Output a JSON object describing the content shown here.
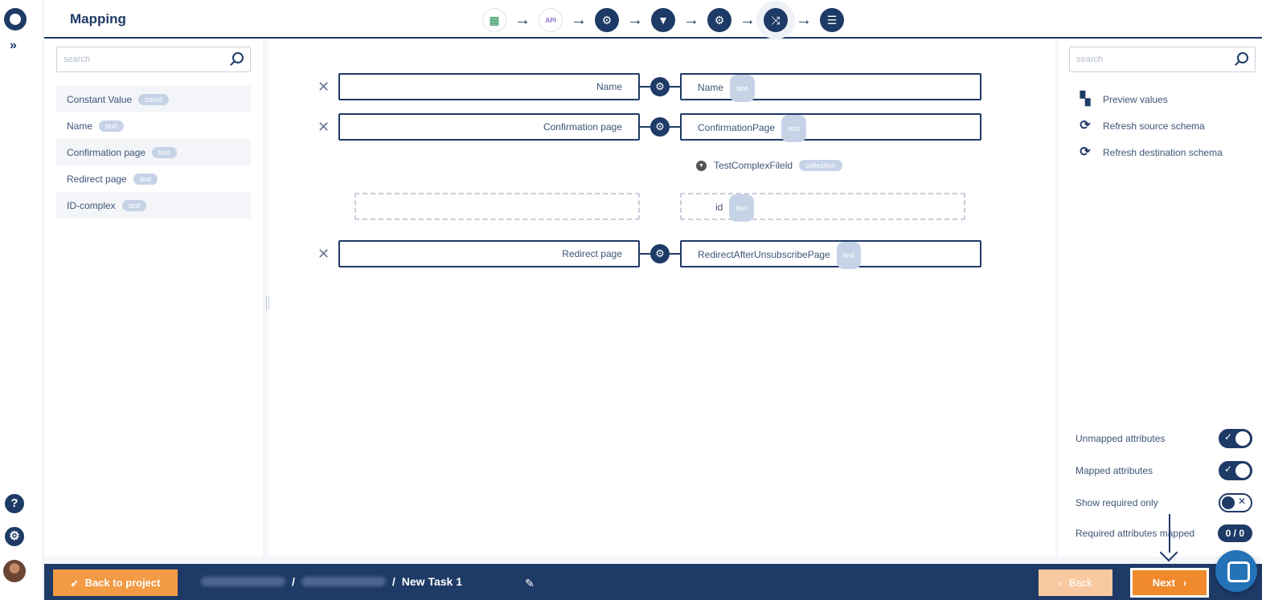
{
  "header": {
    "title": "Mapping",
    "steps": [
      {
        "icon": "spreadsheet-icon",
        "glyph": "▦"
      },
      {
        "icon": "api-gear-icon",
        "glyph": "API"
      },
      {
        "icon": "settings-icon",
        "glyph": "⚙"
      },
      {
        "icon": "filter-icon",
        "glyph": "▼"
      },
      {
        "icon": "settings-icon",
        "glyph": "⚙"
      },
      {
        "icon": "shuffle-icon",
        "glyph": "⤨"
      },
      {
        "icon": "sliders-icon",
        "glyph": "☰"
      }
    ]
  },
  "left": {
    "search_placeholder": "search",
    "items": [
      {
        "label": "Constant Value",
        "badge": "const"
      },
      {
        "label": "Name",
        "badge": "text"
      },
      {
        "label": "Confirmation page",
        "badge": "text"
      },
      {
        "label": "Redirect page",
        "badge": "text"
      },
      {
        "label": "ID-complex",
        "badge": "text"
      }
    ]
  },
  "mappings": [
    {
      "source": "Name",
      "destination": "Name",
      "badge": "text"
    },
    {
      "source": "Confirmation page",
      "destination": "ConfirmationPage",
      "badge": "text"
    },
    {
      "collection_label": "TestComplexFileld",
      "collection_badge": "collection",
      "child_destination": "id",
      "child_badge": "text"
    },
    {
      "source": "Redirect page",
      "destination": "RedirectAfterUnsubscribePage",
      "badge": "text"
    }
  ],
  "right": {
    "search_placeholder": "search",
    "actions": [
      {
        "label": "Preview values",
        "icon": "binoculars-icon"
      },
      {
        "label": "Refresh source schema",
        "icon": "refresh-icon"
      },
      {
        "label": "Refresh destination schema",
        "icon": "refresh-icon"
      }
    ],
    "toggles": [
      {
        "label": "Unmapped attributes",
        "state": "on"
      },
      {
        "label": "Mapped attributes",
        "state": "on"
      },
      {
        "label": "Show required only",
        "state": "off"
      }
    ],
    "required_label": "Required attributes mapped",
    "required_count": "0 / 0"
  },
  "footer": {
    "back_to_project": "Back to project",
    "task_name": "New Task 1",
    "back": "Back",
    "next": "Next"
  }
}
